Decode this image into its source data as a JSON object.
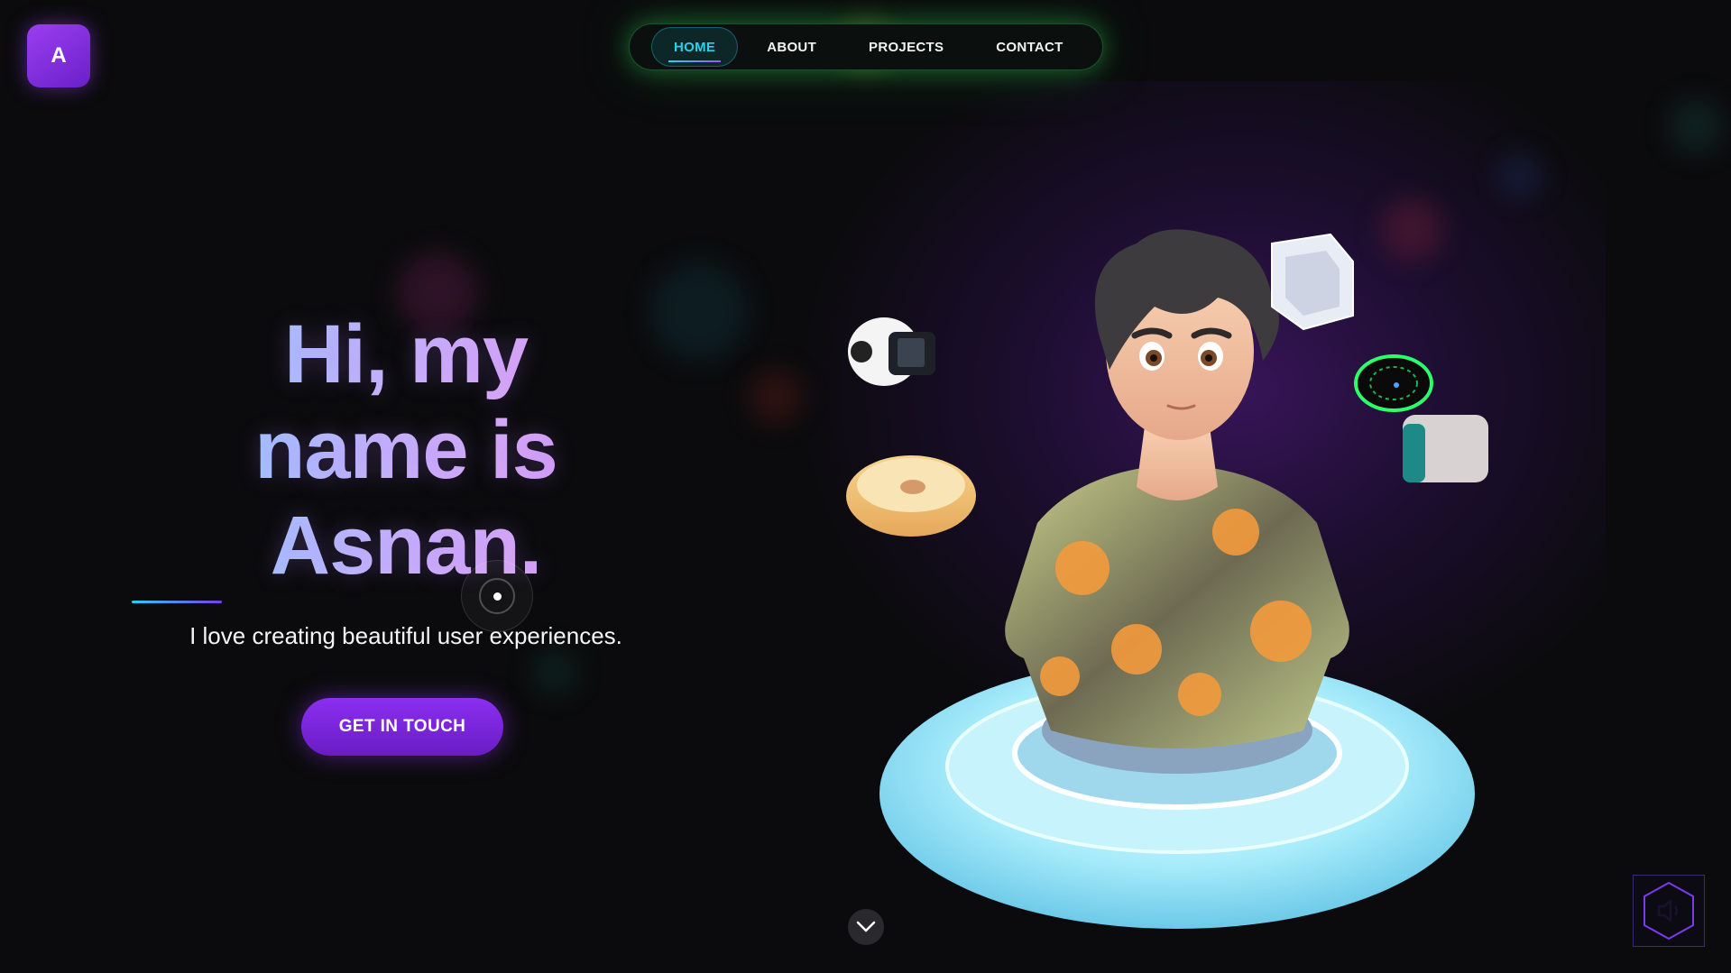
{
  "logo": {
    "letter": "A"
  },
  "nav": {
    "items": [
      {
        "label": "HOME",
        "active": true
      },
      {
        "label": "ABOUT",
        "active": false
      },
      {
        "label": "PROJECTS",
        "active": false
      },
      {
        "label": "CONTACT",
        "active": false
      }
    ]
  },
  "hero": {
    "title_line1": "Hi, my",
    "title_line2": "name is",
    "title_line3": "Asnan.",
    "subtitle": "I love creating beautiful user experiences.",
    "cta_label": "GET IN TOUCH"
  },
  "colors": {
    "accent_cyan": "#22d3ee",
    "accent_purple": "#8b2ff0",
    "nav_glow": "#28c850",
    "background": "#0b0b0d"
  },
  "icons": {
    "scroll": "chevron-down-icon",
    "sound": "speaker-muted-icon"
  }
}
